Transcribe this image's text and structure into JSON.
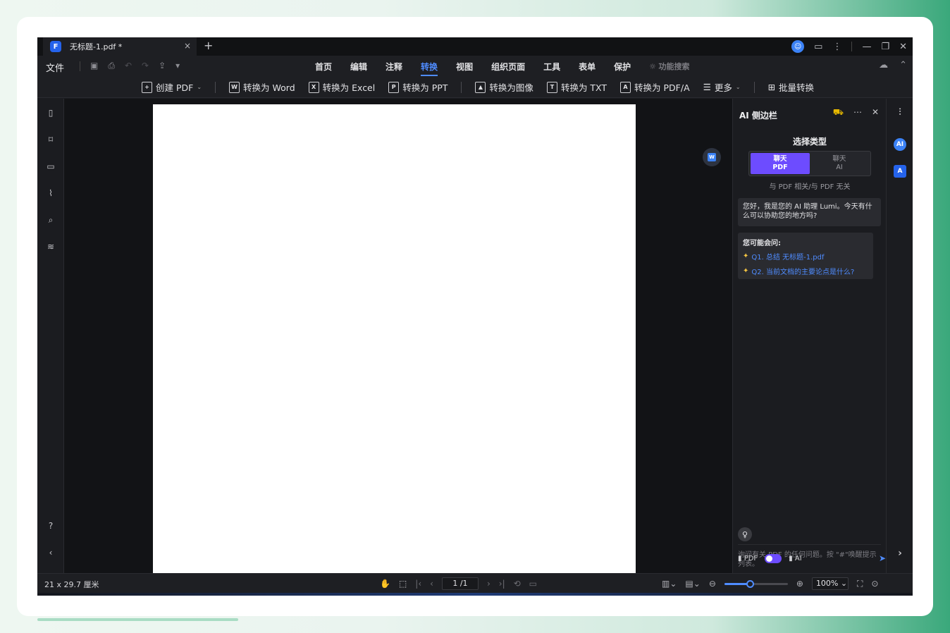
{
  "titlebar": {
    "tab_title": "无标题-1.pdf *",
    "tab_close": "×",
    "new_tab": "+",
    "logo_icon": "app-logo-icon",
    "controls": [
      "account-icon",
      "feedback-icon",
      "more-vertical-icon",
      "minimize-icon",
      "restore-icon",
      "close-icon"
    ]
  },
  "menubar": {
    "file": "文件",
    "items": [
      "首页",
      "编辑",
      "注释",
      "转换",
      "视图",
      "组织页面",
      "工具",
      "表单",
      "保护"
    ],
    "active": "转换",
    "feature_search": "功能搜索"
  },
  "toolbar": {
    "create_pdf": "创建 PDF",
    "to_word": "转换为 Word",
    "to_excel": "转换为 Excel",
    "to_ppt": "转换为 PPT",
    "to_image": "转换为图像",
    "to_txt": "转换为 TXT",
    "to_pdfa": "转换为 PDF/A",
    "more": "更多",
    "batch": "批量转换",
    "icon_letters": {
      "word": "W",
      "excel": "X",
      "ppt": "P",
      "txt": "T",
      "pdfa": "A"
    }
  },
  "ai_panel": {
    "title": "AI 侧边栏",
    "choose_type": "选择类型",
    "option_pdf": [
      "聊天",
      "PDF"
    ],
    "option_ai": [
      "聊天",
      "AI"
    ],
    "selected": "PDF",
    "subtitle": "与 PDF 相关/与 PDF 无关",
    "greeting": "您好，我是您的 AI 助理 Lumi。今天有什么可以协助您的地方吗?",
    "suggest_title": "您可能会问:",
    "questions": [
      "Q1. 总结 无标题-1.pdf",
      "Q2. 当前文档的主要论点是什么?"
    ],
    "input_placeholder": "询问有关 PDF 的任何问题。按 \"#\"唤醒提示列表。",
    "footer_pdf": "PDF",
    "footer_ai": "AI",
    "ai_badge": "AI",
    "translate_badge": "A"
  },
  "statusbar": {
    "page_size": "21 x 29.7 厘米",
    "page_indicator": "1 /1",
    "zoom": "100%",
    "zoom_level": 0.4
  },
  "colors": {
    "accent": "#4f8cff",
    "toggle_active": "#6d4cff",
    "brand": "#2563eb"
  }
}
